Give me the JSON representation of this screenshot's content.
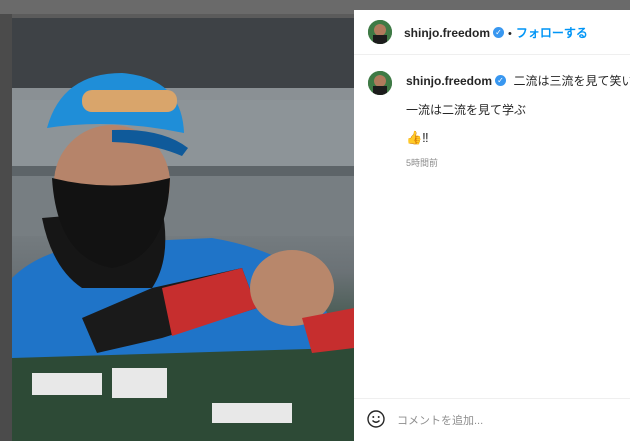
{
  "post": {
    "username": "shinjo.freedom",
    "follow_label": "フォローする",
    "caption_line1": "二流は三流を見て笑い",
    "caption_line2": "一流は二流を見て学ぶ",
    "emoji_line": "👍‼",
    "timestamp": "5時間前"
  },
  "comment": {
    "placeholder": "コメントを追加..."
  },
  "colors": {
    "accent": "#0095f6",
    "verified": "#3897f0",
    "text": "#262626",
    "muted": "#8e8e8e"
  },
  "icons": [
    "verified-badge-icon",
    "smile-icon"
  ]
}
